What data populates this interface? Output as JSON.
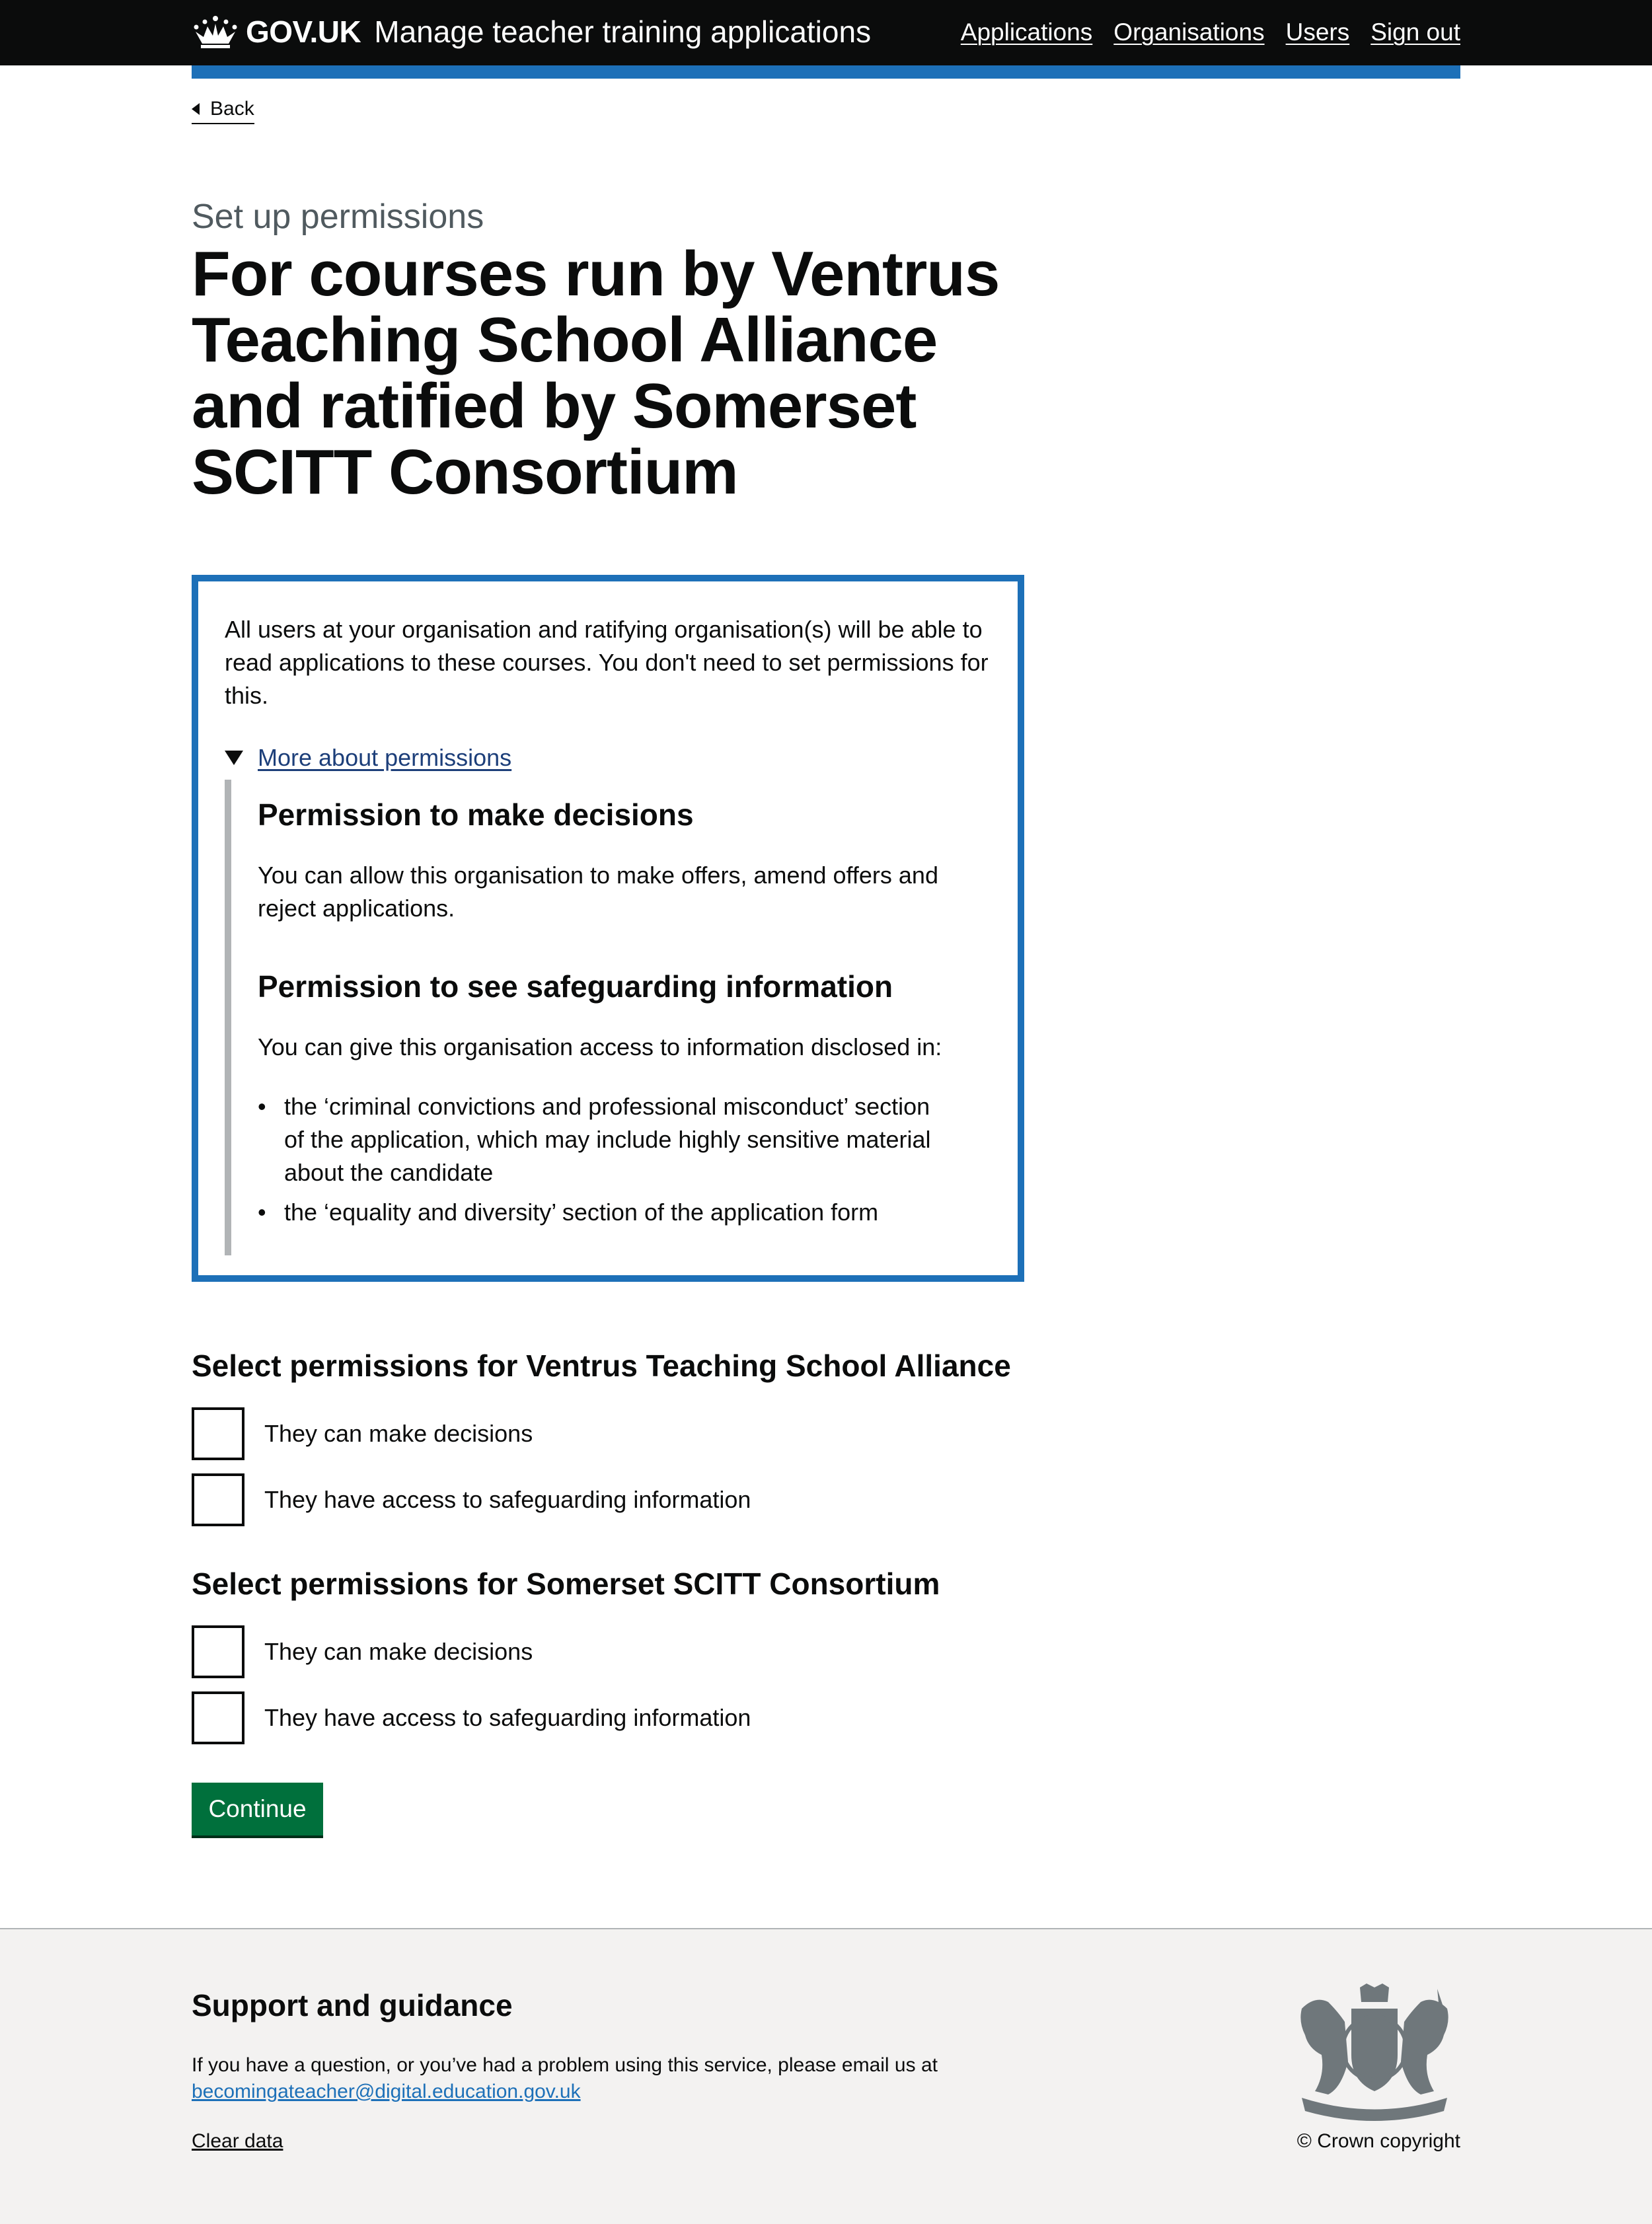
{
  "header": {
    "logo_text": "GOV.UK",
    "service_name": "Manage teacher training applications",
    "nav": [
      "Applications",
      "Organisations",
      "Users",
      "Sign out"
    ]
  },
  "back_label": "Back",
  "caption": "Set up permissions",
  "title": "For courses run by Ventrus Teaching School Alliance and ratified by Somerset SCITT Consortium",
  "inset": {
    "intro": "All users at your organisation and ratifying organisation(s) will be able to read applications to these courses. You don't need to set permissions for this.",
    "details_summary": "More about permissions",
    "decisions_heading": "Permission to make decisions",
    "decisions_text": "You can allow this organisation to make offers, amend offers and reject applications.",
    "safeguarding_heading": "Permission to see safeguarding information",
    "safeguarding_text": "You can give this organisation access to information disclosed in:",
    "bullets": [
      "the ‘criminal convictions and professional misconduct’ section of the application, which may include highly sensitive material about the candidate",
      "the ‘equality and diversity’ section of the application form"
    ]
  },
  "fieldsets": [
    {
      "legend": "Select permissions for Ventrus Teaching School Alliance",
      "options": [
        {
          "label": "They can make decisions",
          "checked": false
        },
        {
          "label": "They have access to safeguarding information",
          "checked": false
        }
      ]
    },
    {
      "legend": "Select permissions for Somerset SCITT Consortium",
      "options": [
        {
          "label": "They can make decisions",
          "checked": false
        },
        {
          "label": "They have access to safeguarding information",
          "checked": false
        }
      ]
    }
  ],
  "continue_label": "Continue",
  "footer": {
    "heading": "Support and guidance",
    "text": "If you have a question, or you’ve had a problem using this service, please email us at",
    "email": "becomingateacher@digital.education.gov.uk",
    "clear_data": "Clear data",
    "copyright": "© Crown copyright"
  },
  "colors": {
    "header_bg": "#0b0c0c",
    "brand_blue": "#1d70b8",
    "button_green": "#00703c",
    "footer_bg": "#f3f2f1"
  }
}
